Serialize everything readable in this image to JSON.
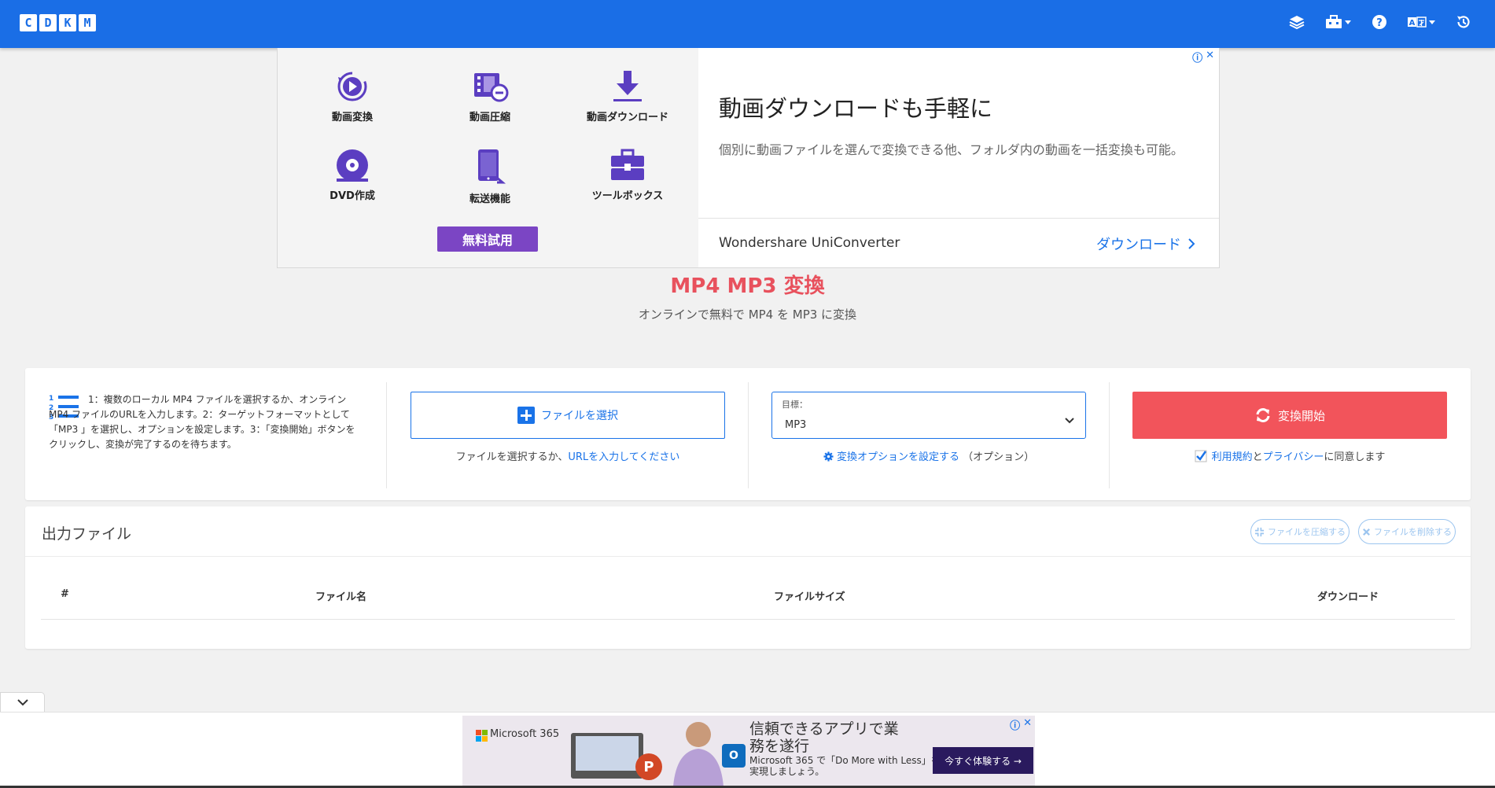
{
  "header": {
    "logo_letters": [
      "C",
      "D",
      "K",
      "M"
    ],
    "icons": [
      "layers-icon",
      "toolbox-icon",
      "help-icon",
      "language-icon",
      "history-icon"
    ],
    "brand_color": "#1a6ee6"
  },
  "ad_top": {
    "apps": [
      {
        "label": "動画変換",
        "icon": "video-convert-icon"
      },
      {
        "label": "動画圧縮",
        "icon": "video-compress-icon"
      },
      {
        "label": "動画ダウンロード",
        "icon": "download-icon"
      },
      {
        "label": "DVD作成",
        "icon": "dvd-icon"
      },
      {
        "label": "転送機能",
        "icon": "transfer-icon"
      },
      {
        "label": "ツールボックス",
        "icon": "toolbox-icon"
      }
    ],
    "trial_label": "無料試用",
    "headline": "動画ダウンロードも手軽に",
    "body": "個別に動画ファイルを選んで変換できる他、フォルダ内の動画を一括変換も可能。",
    "brand": "Wondershare UniConverter",
    "cta": "ダウンロード"
  },
  "page": {
    "title": "MP4 MP3 変換",
    "subtitle": "オンラインで無料で MP4 を MP3 に変換"
  },
  "converter": {
    "instructions": "1：複数のローカル MP4 ファイルを選択するか、オンライン MP4 ファイルのURLを入力します。2：ターゲットフォーマットとして「MP3 」を選択し、オプションを設定します。3：「変換開始」ボタンをクリックし、変換が完了するのを待ちます。",
    "file_button": "ファイルを選択",
    "file_hint_prefix": "ファイルを選択するか、",
    "file_hint_link": "URLを入力してください",
    "target_label": "目標：",
    "target_value": "MP3",
    "options_link": "変換オプションを設定する",
    "options_suffix": "（オプション）",
    "start_button": "変換開始",
    "agree_terms": "利用規約",
    "agree_and": "と",
    "agree_privacy": "プライバシー",
    "agree_suffix": "に同意します",
    "agree_checked": true,
    "accent_color": "#f2545b"
  },
  "output": {
    "title": "出力ファイル",
    "compress_label": "ファイルを圧縮する",
    "delete_label": "ファイルを削除する",
    "columns": [
      "#",
      "ファイル名",
      "ファイルサイズ",
      "ダウンロード"
    ]
  },
  "ad_bottom": {
    "brand": "Microsoft 365",
    "headline": "信頼できるアプリで業務を遂行",
    "sub": "Microsoft 365 で「Do More with Less」を実現しましょう。",
    "cta": "今すぐ体験する →"
  }
}
